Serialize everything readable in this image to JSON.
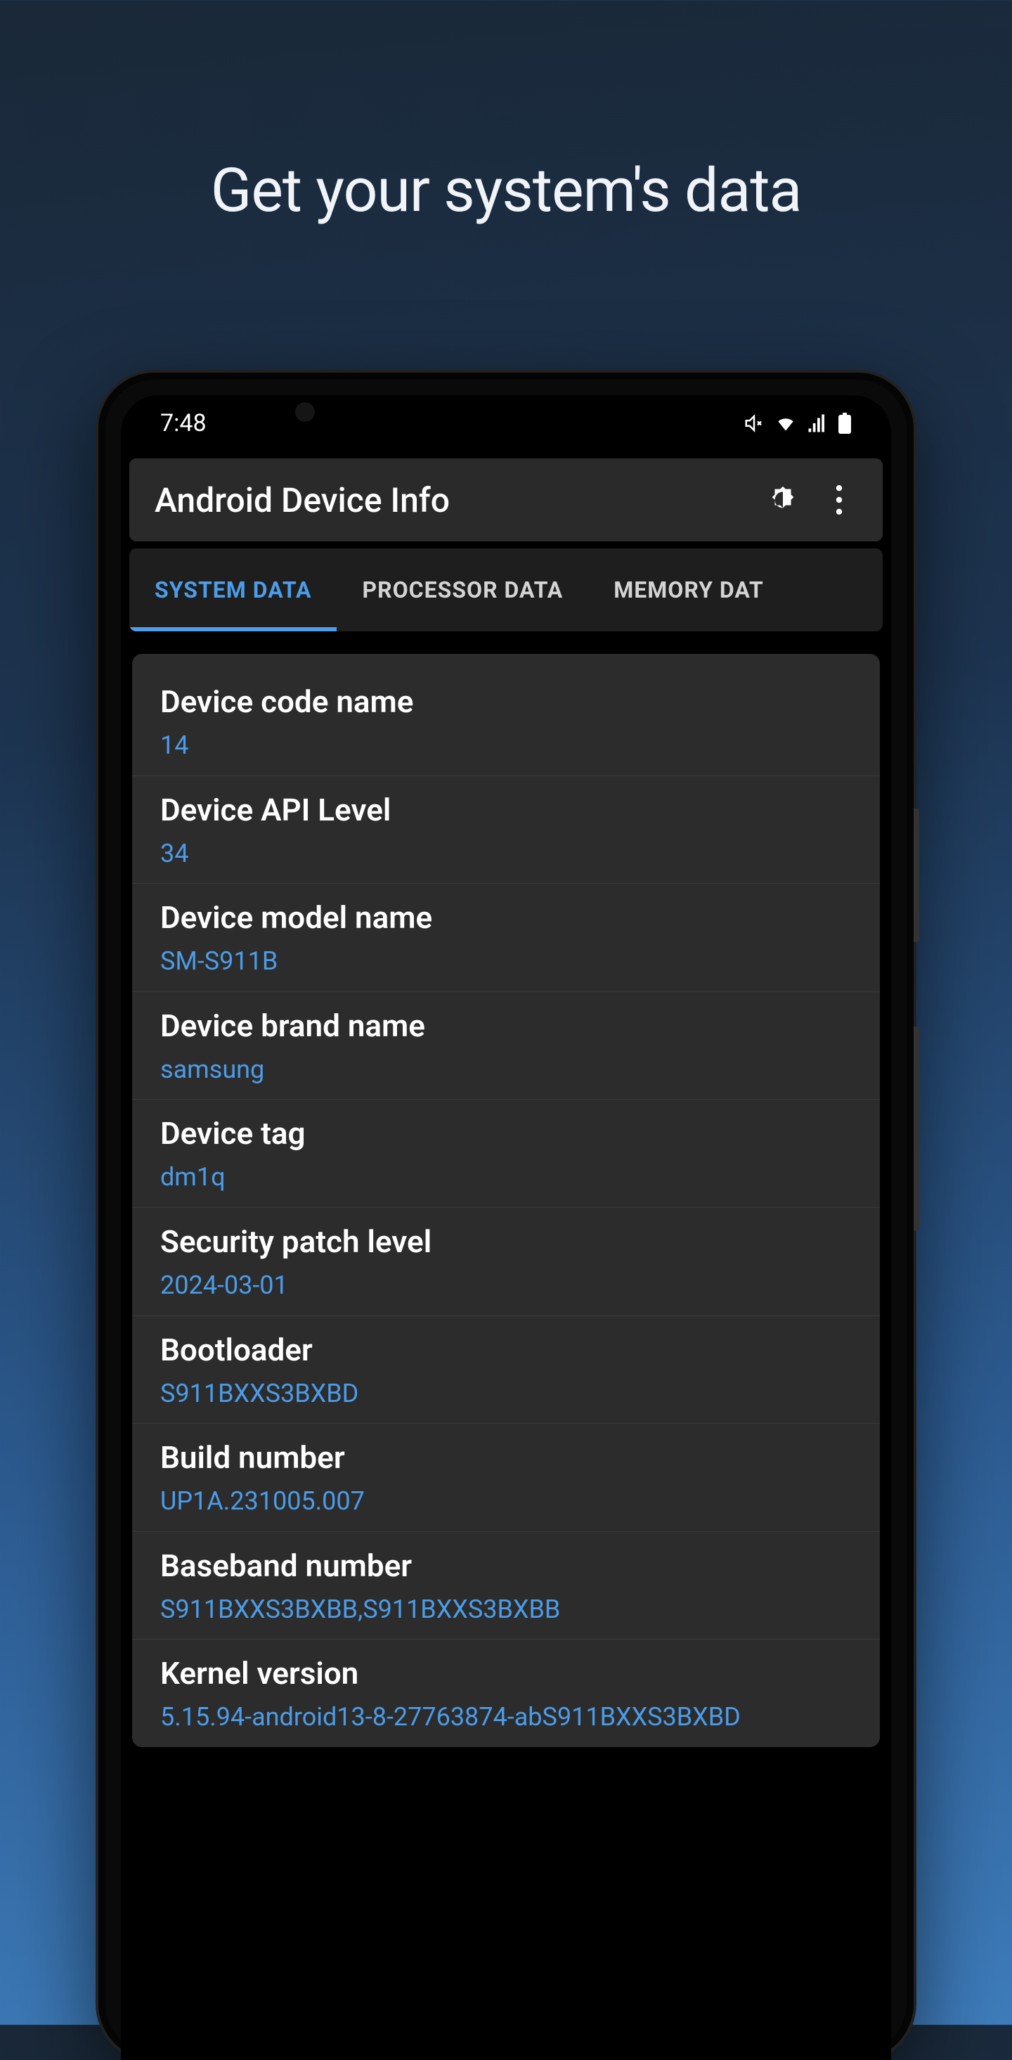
{
  "promo": {
    "title": "Get your system's data"
  },
  "status": {
    "time": "7:48"
  },
  "header": {
    "title": "Android Device Info"
  },
  "tabs": [
    {
      "label": "SYSTEM DATA",
      "active": true
    },
    {
      "label": "PROCESSOR DATA",
      "active": false
    },
    {
      "label": "MEMORY DAT",
      "active": false
    }
  ],
  "rows": [
    {
      "label": "Device code name",
      "value": "14"
    },
    {
      "label": "Device API Level",
      "value": "34"
    },
    {
      "label": "Device model name",
      "value": "SM-S911B"
    },
    {
      "label": "Device brand name",
      "value": "samsung"
    },
    {
      "label": "Device tag",
      "value": "dm1q"
    },
    {
      "label": "Security patch level",
      "value": "2024-03-01"
    },
    {
      "label": "Bootloader",
      "value": "S911BXXS3BXBD"
    },
    {
      "label": "Build number",
      "value": "UP1A.231005.007"
    },
    {
      "label": "Baseband number",
      "value": "S911BXXS3BXBB,S911BXXS3BXBB"
    },
    {
      "label": "Kernel version",
      "value": "5.15.94-android13-8-27763874-abS911BXXS3BXBD"
    }
  ]
}
